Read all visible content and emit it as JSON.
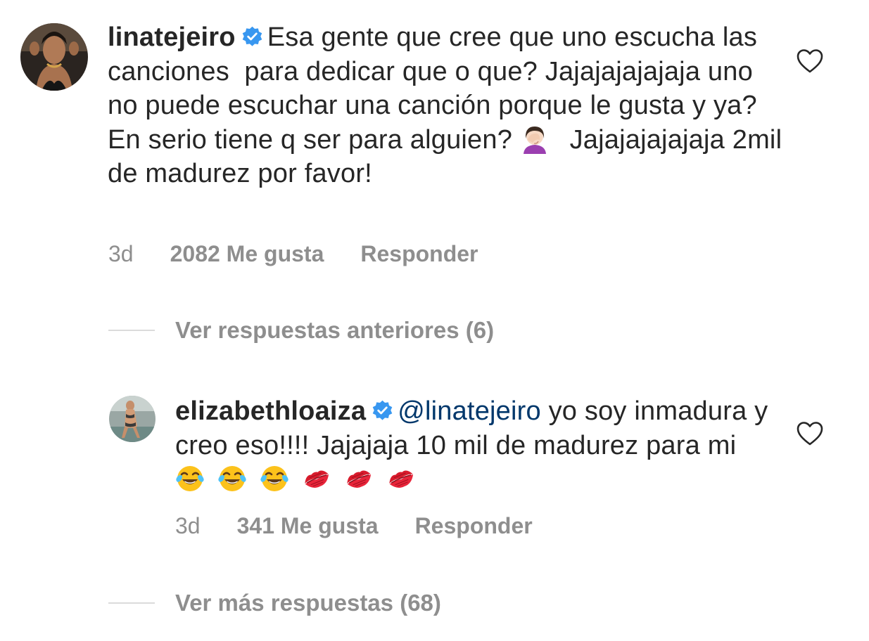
{
  "comments": [
    {
      "username": "linatejeiro",
      "verified": true,
      "text_part1": "Esa gente que cree que uno escucha las canciones  para dedicar que o que? Jajajajajajaja uno no puede escuchar una canción porque le gusta y ya? En serio tiene q ser para alguien? ",
      "emoji": "woman-facepalming-emoji",
      "text_part2": " Jajajajajajaja 2mil de madurez por favor!",
      "time": "3d",
      "likes": "2082 Me gusta",
      "reply_label": "Responder",
      "liked": false
    },
    {
      "username": "elizabethloaiza",
      "verified": true,
      "mention": "@linatejeiro",
      "text": " yo soy inmadura y creo eso!!!! Jajajaja 10 mil de madurez para mi ",
      "emojis": [
        "tears-of-joy-emoji",
        "tears-of-joy-emoji",
        "tears-of-joy-emoji",
        "kiss-mark-emoji",
        "kiss-mark-emoji",
        "kiss-mark-emoji"
      ],
      "time": "3d",
      "likes": "341 Me gusta",
      "reply_label": "Responder",
      "liked": false
    }
  ],
  "view_previous_replies": "Ver respuestas anteriores (6)",
  "view_more_replies": "Ver más respuestas (68)",
  "colors": {
    "text": "#262626",
    "secondary": "#8e8e8e",
    "verified": "#3897f0",
    "mention": "#00376b",
    "divider": "#dbdbdb"
  }
}
